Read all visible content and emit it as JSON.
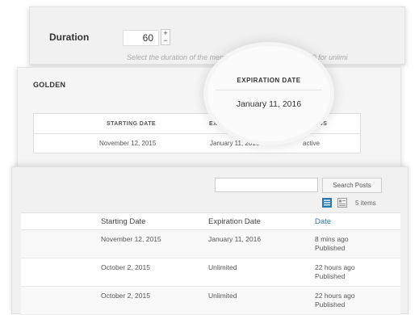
{
  "duration": {
    "label": "Duration",
    "value": "60",
    "help": "Select the duration of the membership plan (in days). Set 0 for unlimi"
  },
  "plan": {
    "name": "GOLDEN",
    "headers": [
      "STARTING DATE",
      "EXPIRATION DATE",
      "STATUS"
    ],
    "row": {
      "start": "November 12, 2015",
      "expiration": "January 11, 2016",
      "status": "active"
    }
  },
  "magnifier": {
    "header": "EXPIRATION DATE",
    "value": "January 11, 2016"
  },
  "posts": {
    "search_button": "Search Posts",
    "items_count": "5 items",
    "columns": [
      "Starting Date",
      "Expiration Date",
      "Date"
    ],
    "rows": [
      {
        "start": "November 12, 2015",
        "expiration": "January 11, 2016",
        "date": "8 mins ago",
        "status": "Published"
      },
      {
        "start": "October 2, 2015",
        "expiration": "Unlimited",
        "date": "22 hours ago",
        "status": "Published"
      },
      {
        "start": "October 2, 2015",
        "expiration": "Unlimited",
        "date": "22 hours ago",
        "status": "Published"
      }
    ]
  },
  "colors": {
    "link": "#2a7ab0",
    "icon_active": "#2a7ab0",
    "icon_inactive": "#999999"
  }
}
